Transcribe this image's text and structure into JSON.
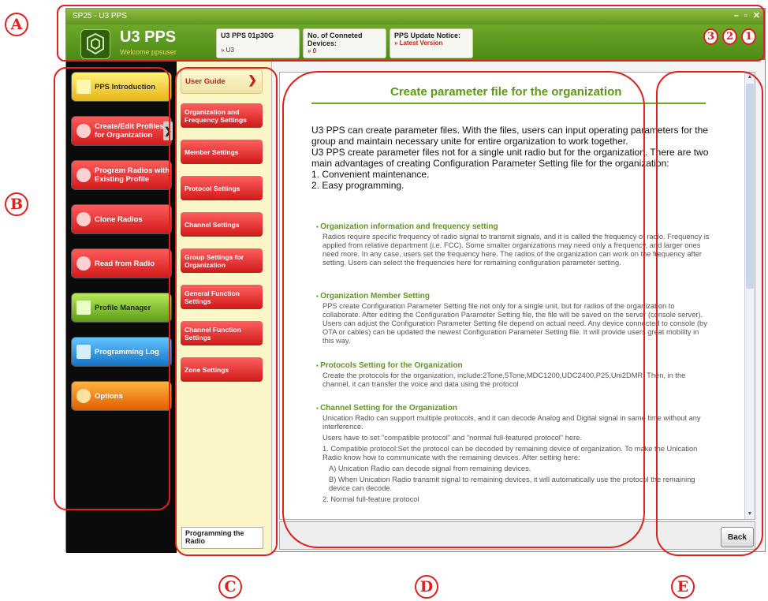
{
  "window": {
    "title": "SP25 - U3 PPS",
    "controls": [
      "–",
      "▫",
      "✕"
    ]
  },
  "header": {
    "app_name": "U3 PPS",
    "welcome": "Welcome ppsuser",
    "cards": [
      {
        "title": "U3 PPS 01p30G",
        "value": "» U3"
      },
      {
        "title": "No. of Conneted Devices:",
        "value": "» 0"
      },
      {
        "title": "PPS Update Notice:",
        "value": "» Latest Version"
      }
    ]
  },
  "sidebar": {
    "items": [
      {
        "label": "PPS Introduction",
        "icon": "document-icon",
        "style": "yellow"
      },
      {
        "label": "Create/Edit Profiles for Organization",
        "icon": "radio-icon",
        "style": "red",
        "selected": true
      },
      {
        "label": "Program Radios with Existing Profile",
        "icon": "radio-icon",
        "style": "red"
      },
      {
        "label": "Clone Radios",
        "icon": "radio-icon",
        "style": "red"
      },
      {
        "label": "Read from Radio",
        "icon": "radio-icon",
        "style": "red"
      },
      {
        "label": "Profile Manager",
        "icon": "folder-icon",
        "style": "green"
      },
      {
        "label": "Programming Log",
        "icon": "log-icon",
        "style": "blue"
      },
      {
        "label": "Options",
        "icon": "gear-icon",
        "style": "orange"
      }
    ]
  },
  "subnav": {
    "items": [
      {
        "label": "User Guide",
        "selected": true
      },
      {
        "label": "Organization and Frequency Settings"
      },
      {
        "label": "Member Settings"
      },
      {
        "label": "Protocol Settings"
      },
      {
        "label": "Channel Settings"
      },
      {
        "label": "Group Settings for Organization"
      },
      {
        "label": "General Function Settings"
      },
      {
        "label": "Channel Function Settings"
      },
      {
        "label": "Zone Settings"
      }
    ],
    "footer": "Programming the Radio"
  },
  "content": {
    "heading": "Create parameter file for the organization",
    "intro": [
      "U3 PPS can create parameter files. With the files, users can input operating parameters for the group and maintain necessary unite for entire organization to work together.",
      "U3 PPS create parameter files not for a single unit radio but for the organization. There are two main advantages of creating Configuration Parameter Setting file for the organization:"
    ],
    "advantages": [
      "1. Convenient maintenance.",
      "2. Easy programming."
    ],
    "sections": [
      {
        "title": "Organization information and frequency setting",
        "body": "Radios require specific frequency of radio signal to transmit signals, and it is called the frequency of radio. Frequency is applied from relative department (i.e. FCC). Some smaller organizations may need only a frequency, and larger ones need more. In any case, users set the frequency here. The radios of the organization can work on the frequency after setting. Users can select the frequencies here for remaining configuration parameter setting."
      },
      {
        "title": "Organization Member Setting",
        "body": "PPS create Configuration Parameter Setting file not only for a single unit, but for radios of the organization to collaborate. After editing the Configuration Parameter Setting file, the file will be saved on the server (console server). Users can adjust the Configuration Parameter Setting file depend on actual need. Any device connected to console (by OTA or cables) can be updated the newest Configuration Parameter Setting file. It will provide users great mobility in this way."
      },
      {
        "title": "Protocols Setting for the Organization",
        "body": "Create the protocols for the organization, include:2Tone,5Tone,MDC1200,UDC2400,P25,Uni2DMR. Then, in the channel, it can transfer the voice and data using the protocol"
      },
      {
        "title": "Channel Setting for the Organization",
        "body": "Unication Radio can support multiple protocols, and it can decode Analog and Digital signal in same time without any interference."
      }
    ],
    "channel_extra": [
      "Users have to set \"compatible protocol\" and \"normal full-featured protocol\" here.",
      "1. Compatible protocol:Set the protocol can be decoded by remaining device of organization. To make the Unication Radio know how to communicate with the remaining devices. After setting here:",
      "A) Unication Radio can decode signal from remaining devices.",
      "B) When Unication Radio transmit signal to remaining devices, it will automatically use the protocol the remaining device can decode.",
      "2. Normal full-feature protocol"
    ]
  },
  "back_button": "Back",
  "annotations": {
    "letters": [
      "A",
      "B",
      "C",
      "D",
      "E"
    ],
    "numbers": [
      "3",
      "2",
      "1"
    ]
  }
}
